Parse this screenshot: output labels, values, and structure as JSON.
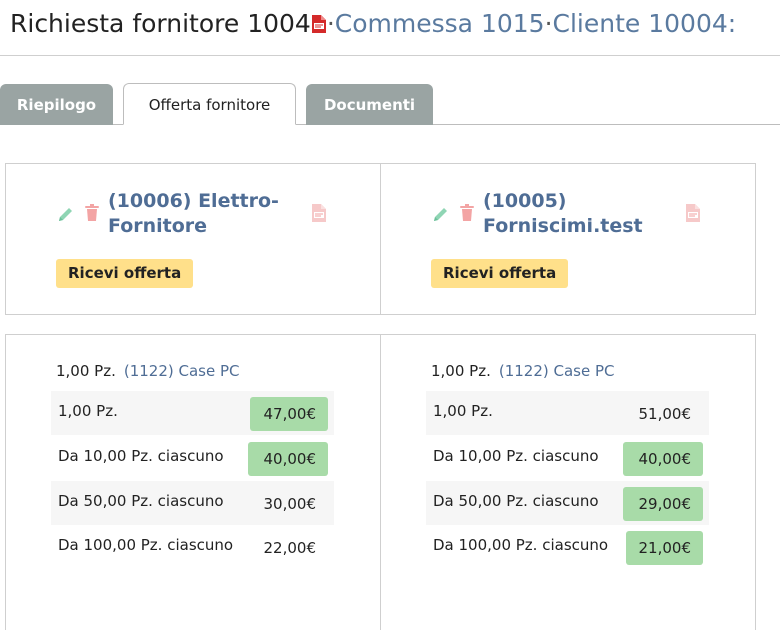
{
  "header": {
    "title": "Richiesta fornitore 1004",
    "pdf_icon": "pdf-file-icon",
    "separator": "·",
    "commessa": "Commessa 1015",
    "cliente": "Cliente 10004:"
  },
  "tabs": [
    {
      "label": "Riepilogo"
    },
    {
      "label": "Offerta fornitore"
    },
    {
      "label": "Documenti"
    }
  ],
  "suppliers": [
    {
      "name_line1": "(10006) Elettro-",
      "name_line2": "Fornitore",
      "badge": "Ricevi offerta",
      "product_qty": "1,00 Pz.",
      "product_name": "(1122) Case PC",
      "rows": [
        {
          "label": "1,00 Pz.",
          "price": "47,00€"
        },
        {
          "label": "Da 10,00 Pz. ciascuno",
          "price": "40,00€"
        },
        {
          "label": "Da 50,00 Pz. ciascuno",
          "price": "30,00€"
        },
        {
          "label": "Da 100,00 Pz. ciascuno",
          "price": "22,00€"
        }
      ]
    },
    {
      "name_line1": "(10005)",
      "name_line2": "Forniscimi.test",
      "badge": "Ricevi offerta",
      "product_qty": "1,00 Pz.",
      "product_name": "(1122) Case PC",
      "rows": [
        {
          "label": "1,00 Pz.",
          "price": "51,00€"
        },
        {
          "label": "Da 10,00 Pz. ciascuno",
          "price": "40,00€"
        },
        {
          "label": "Da 50,00 Pz. ciascuno",
          "price": "29,00€"
        },
        {
          "label": "Da 100,00 Pz. ciascuno",
          "price": "21,00€"
        }
      ]
    }
  ],
  "colors": {
    "link": "#4f6d95",
    "badge": "#ffe08a",
    "price_highlight": "#a8dba8",
    "tab_inactive": "#9aa4a3"
  }
}
